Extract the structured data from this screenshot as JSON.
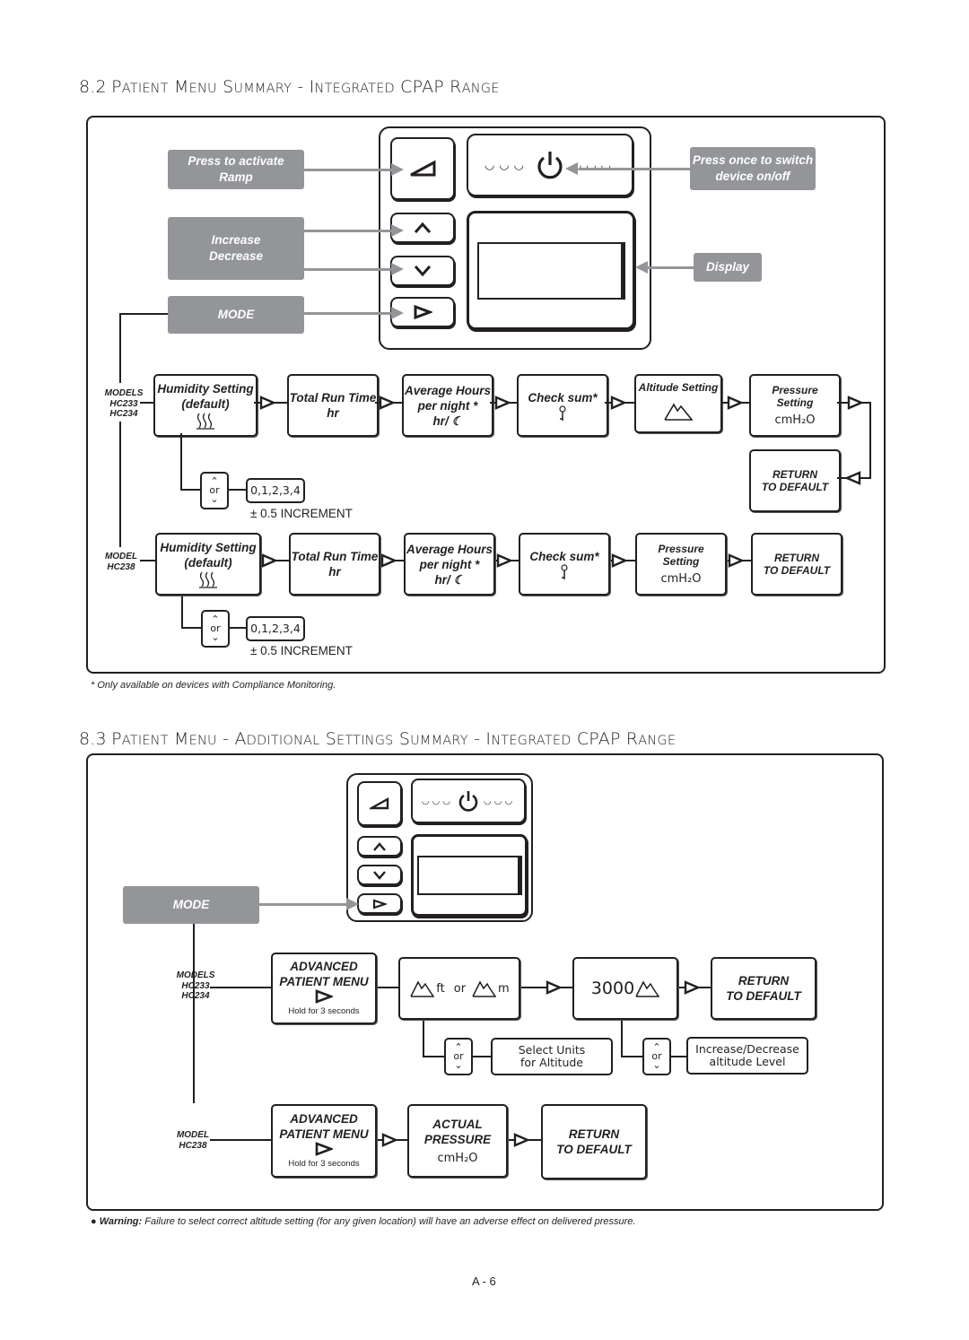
{
  "section_82": {
    "number": "8.2",
    "title": "Patient Menu Summary - Integrated CPAP Range",
    "callouts": {
      "ramp": [
        "Press to activate",
        "Ramp"
      ],
      "inc_dec": [
        "Increase",
        "Decrease"
      ],
      "mode": "MODE",
      "power": [
        "Press once to switch",
        "device on/off"
      ],
      "display": "Display"
    },
    "row1": {
      "models_label": [
        "MODELS",
        "HC233",
        "HC234"
      ],
      "steps": [
        {
          "lines": [
            "Humidity Setting",
            "(default)"
          ],
          "icon": "humidity-icon"
        },
        {
          "lines": [
            "Total Run Time",
            "hr"
          ]
        },
        {
          "lines": [
            "Average Hours",
            "per night *",
            "hr/ ☾"
          ],
          "icon": "moon-icon"
        },
        {
          "lines": [
            "Check sum*"
          ],
          "icon": "key-icon"
        },
        {
          "lines": [
            "Altitude Setting"
          ],
          "icon": "mountain-icon"
        },
        {
          "lines": [
            "Pressure",
            "Setting"
          ],
          "unit": "cmH₂O"
        },
        {
          "lines": [
            "RETURN",
            "TO DEFAULT"
          ]
        }
      ],
      "adjust": {
        "or_label": "or",
        "values": "0,1,2,3,4",
        "increment": "± 0.5 INCREMENT"
      }
    },
    "row2": {
      "models_label": [
        "MODEL",
        "HC238"
      ],
      "steps": [
        {
          "lines": [
            "Humidity Setting",
            "(default)"
          ],
          "icon": "humidity-icon"
        },
        {
          "lines": [
            "Total Run Time",
            "hr"
          ]
        },
        {
          "lines": [
            "Average Hours",
            "per night *",
            "hr/ ☾"
          ],
          "icon": "moon-icon"
        },
        {
          "lines": [
            "Check sum*"
          ],
          "icon": "key-icon"
        },
        {
          "lines": [
            "Pressure",
            "Setting"
          ],
          "unit": "cmH₂O"
        },
        {
          "lines": [
            "RETURN",
            "TO DEFAULT"
          ]
        }
      ],
      "adjust": {
        "or_label": "or",
        "values": "0,1,2,3,4",
        "increment": "± 0.5 INCREMENT"
      }
    },
    "footnote": "* Only available on devices with Compliance Monitoring."
  },
  "section_83": {
    "number": "8.3",
    "title": "Patient Menu - Additional Settings Summary - Integrated CPAP Range",
    "mode_callout": "MODE",
    "row1": {
      "models_label": [
        "MODELS",
        "HC233",
        "HC234"
      ],
      "advanced": {
        "lines": [
          "ADVANCED",
          "PATIENT MENU"
        ],
        "hint": "Hold for 3 seconds"
      },
      "units": {
        "ft": "ft",
        "or": "or",
        "m": "m"
      },
      "altitude_value": "3000",
      "return": [
        "RETURN",
        "TO DEFAULT"
      ],
      "units_adjust": {
        "or_label": "or",
        "label": [
          "Select Units",
          "for Altitude"
        ]
      },
      "altitude_adjust": {
        "or_label": "or",
        "label": [
          "Increase/Decrease",
          "altitude Level"
        ]
      }
    },
    "row2": {
      "models_label": [
        "MODEL",
        "HC238"
      ],
      "advanced": {
        "lines": [
          "ADVANCED",
          "PATIENT MENU"
        ],
        "hint": "Hold for 3 seconds"
      },
      "actual": {
        "lines": [
          "ACTUAL",
          "PRESSURE"
        ],
        "unit": "cmH₂O"
      },
      "return": [
        "RETURN",
        "TO DEFAULT"
      ]
    },
    "warning": {
      "label": "Warning:",
      "text": "Failure to select correct altitude setting (for any given location) will have an adverse effect on delivered pressure."
    }
  },
  "page_number": "A - 6"
}
